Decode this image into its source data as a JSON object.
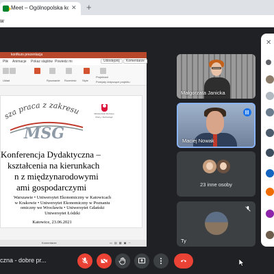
{
  "browser": {
    "tab_title": "Meet – Ogólnopolska konfe",
    "tab_close": "✕",
    "new_tab": "+",
    "url": "w"
  },
  "slide_window": {
    "title": "konfkurs prezentacja",
    "menu": [
      "Plik",
      "Animacje",
      "Pokaz slajdów",
      "Powiedz mi"
    ],
    "share_label": "Udostępnij",
    "comments_label": "Komentarze",
    "toolbar_labels": [
      "Układ",
      "Rysowanie",
      "Rozmieść",
      "Style",
      "Projektant",
      "Pomysły dotyczące projektu"
    ],
    "slide": {
      "arc_text": "sza praca z zakresu",
      "logo_text": "MSG",
      "ministry": [
        "Ministerstwo Rozwoju",
        "Pracy i Technologii"
      ],
      "title_lines": [
        "Konferencja Dydaktyczna –",
        "kształcenia na kierunkach",
        "n z międzynarodowymi",
        "ami gospodarczymi"
      ],
      "universities": [
        "Warszawie • Uniwersytet Ekonomiczny w Katowicach",
        "w Krakowie • Uniwersytet Ekonomiczny w Poznaniu",
        "omiczny we Wrocławiu • Uniwersytet Gdański",
        "Uniwersytet Łódzki"
      ],
      "date": "Katowice, 23.06.2021"
    },
    "status_note": "Komentarze"
  },
  "participants": {
    "tile1_name": "Małgorzata Janicka",
    "tile2_name": "Maciej Nowak",
    "others_label": "23 inne osoby",
    "self_name": "Ty"
  },
  "bottom": {
    "meeting_title": "czna - dobre pr..."
  },
  "colors": {
    "meet_bg": "#202124",
    "danger": "#ea4335",
    "active_speaker": "#8ab4f8",
    "ppt_brand": "#b7472a"
  },
  "icons": {
    "mic": "mic-off-icon",
    "camera": "camera-off-icon",
    "hand": "raise-hand-icon",
    "present": "present-screen-icon",
    "more": "more-vert-icon",
    "hangup": "hang-up-icon"
  }
}
